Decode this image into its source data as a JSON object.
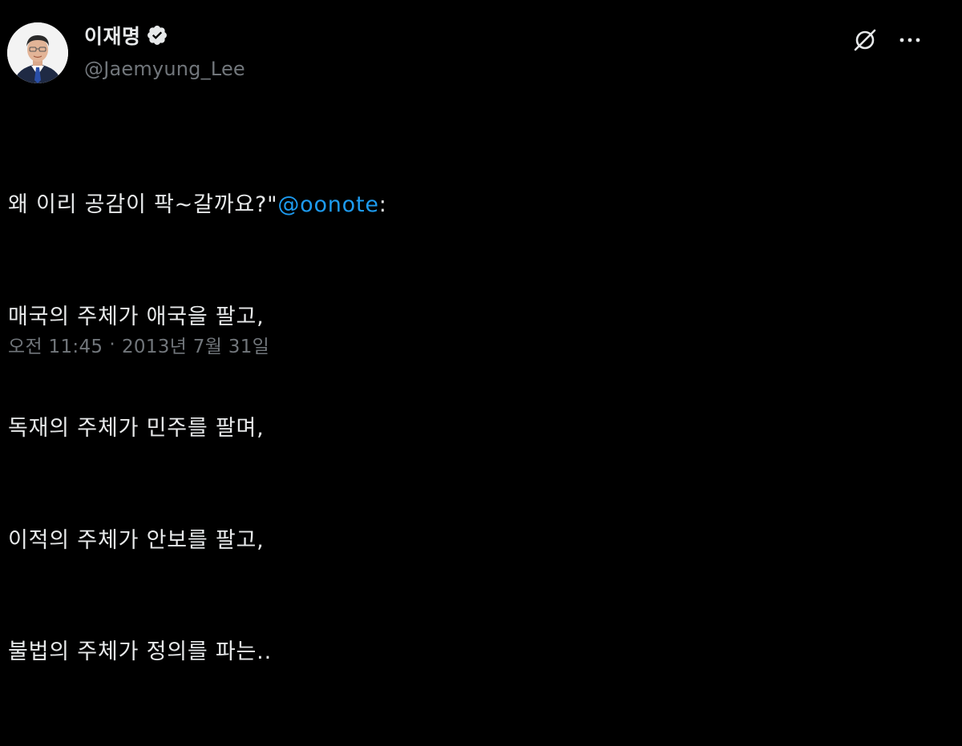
{
  "author": {
    "display_name": "이재명",
    "handle": "@Jaemyung_Lee",
    "verified_color": "#e7e9ea"
  },
  "actions": {
    "grok_icon": "grok-icon",
    "more_icon": "more-icon"
  },
  "tweet": {
    "line1_text": "왜 이리 공감이 팍~갈까요?\"",
    "mention": "@oonote",
    "line1_suffix": ":",
    "lines": [
      "매국의 주체가 애국을 팔고,",
      "독재의 주체가 민주를 팔며,",
      "이적의 주체가 안보를 팔고,",
      "불법의 주체가 정의를 파는.."
    ]
  },
  "meta": {
    "time": "오전 11:45",
    "separator": "·",
    "date": "2013년 7월 31일"
  },
  "colors": {
    "background": "#000000",
    "text": "#e7e9ea",
    "secondary": "#71767b",
    "link": "#1d9bf0"
  }
}
